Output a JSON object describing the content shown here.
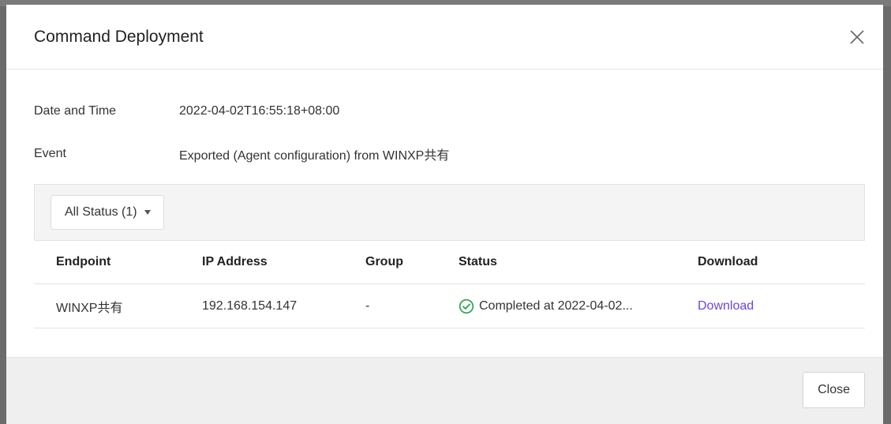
{
  "dialog": {
    "title": "Command Deployment",
    "close_icon": "close-icon"
  },
  "info": {
    "date_label": "Date and Time",
    "date_value": "2022-04-02T16:55:18+08:00",
    "event_label": "Event",
    "event_value": "Exported (Agent configuration) from WINXP共有"
  },
  "filter": {
    "label": "All Status (1)",
    "icon": "caret-down-icon"
  },
  "table": {
    "headers": [
      "Endpoint",
      "IP Address",
      "Group",
      "Status",
      "Download"
    ],
    "rows": [
      {
        "endpoint": "WINXP共有",
        "ip": "192.168.154.147",
        "group": "-",
        "status": "Completed at 2022-04-02...",
        "status_icon": "check-circle-icon",
        "download": "Download"
      }
    ]
  },
  "footer": {
    "close_label": "Close"
  },
  "colors": {
    "success": "#2ea44f",
    "link": "#6f42e1"
  }
}
